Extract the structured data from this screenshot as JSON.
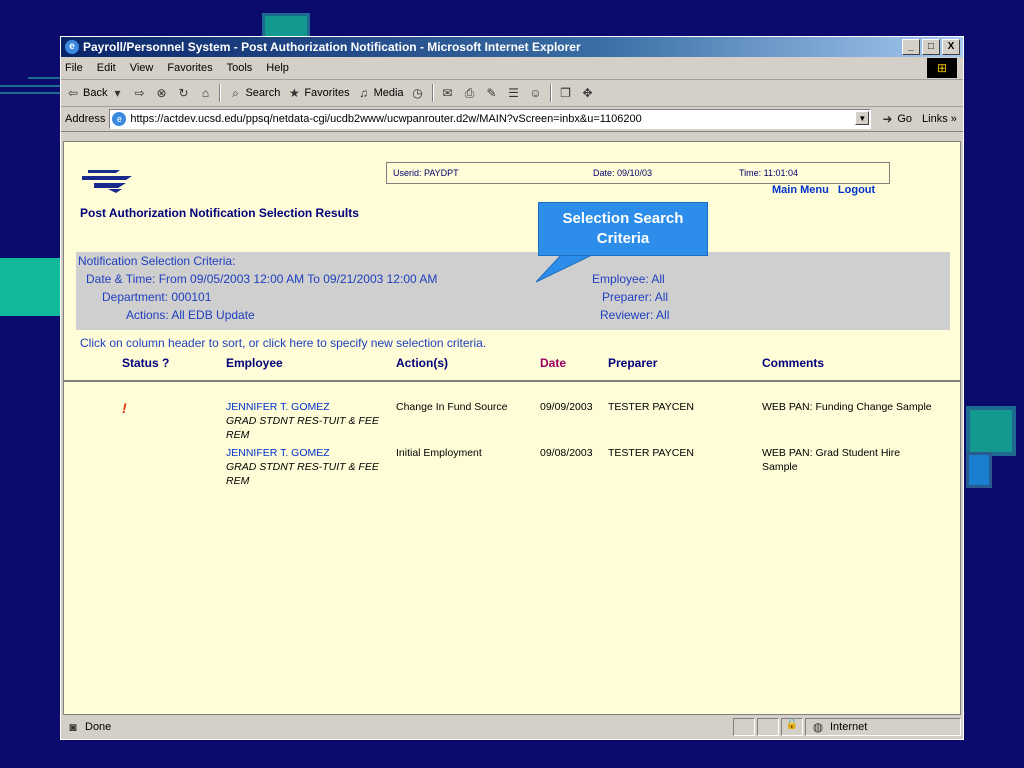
{
  "window": {
    "title": "Payroll/Personnel System - Post Authorization Notification - Microsoft Internet Explorer",
    "buttons": [
      "_",
      "□",
      "X"
    ]
  },
  "menu": [
    "File",
    "Edit",
    "View",
    "Favorites",
    "Tools",
    "Help"
  ],
  "toolbar": {
    "back": "Back",
    "search": "Search",
    "favorites": "Favorites",
    "media": "Media"
  },
  "address": {
    "label": "Address",
    "url": "https://actdev.ucsd.edu/ppsq/netdata-cgi/ucdb2www/ucwpanrouter.d2w/MAIN?vScreen=inbx&u=1106200",
    "go": "Go",
    "links": "Links »"
  },
  "header": {
    "userid": "Userid: PAYDPT",
    "date": "Date: 09/10/03",
    "time": "Time: 11:01:04",
    "main_menu": "Main Menu",
    "logout": "Logout",
    "page_title": "Post Authorization Notification Selection Results"
  },
  "callout": "Selection Search Criteria",
  "criteria": {
    "heading": "Notification Selection Criteria:",
    "datetime": "Date & Time: From 09/05/2003 12:00 AM To 09/21/2003 12:00 AM",
    "department": "Department: 000101",
    "actions": "Actions: All EDB Update",
    "employee": "Employee: All",
    "preparer": "Preparer: All",
    "reviewer": "Reviewer: All"
  },
  "hint": "Click on column header to sort, or click here to specify new selection criteria.",
  "columns": {
    "status": "Status ?",
    "employee": "Employee",
    "actions": "Action(s)",
    "date": "Date",
    "preparer": "Preparer",
    "comments": "Comments"
  },
  "rows": [
    {
      "status": "!",
      "employee": "JENNIFER T. GOMEZ",
      "title": "GRAD STDNT RES-TUIT & FEE REM",
      "action": "Change In Fund Source",
      "date": "09/09/2003",
      "preparer": "TESTER PAYCEN",
      "comment": "WEB PAN: Funding Change Sample"
    },
    {
      "status": "",
      "employee": "JENNIFER T. GOMEZ",
      "title": "GRAD STDNT RES-TUIT & FEE REM",
      "action": "Initial Employment",
      "date": "09/08/2003",
      "preparer": "TESTER PAYCEN",
      "comment": "WEB PAN: Grad Student Hire Sample"
    }
  ],
  "status": {
    "left": "Done",
    "zone": "Internet"
  },
  "colors": {
    "background": "#0b0b6e",
    "page": "#fffdd8",
    "callout": "#2c8eea",
    "date_header": "#990066"
  }
}
